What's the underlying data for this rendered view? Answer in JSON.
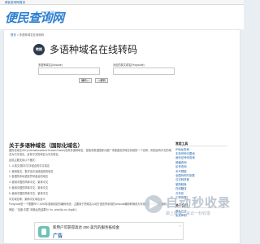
{
  "topbar": {
    "link": "便民查询网首页"
  },
  "header": {
    "logo_text": "便民查询网",
    "logo_url": "www.ip138.com"
  },
  "breadcrumb": {
    "prefix": "首页",
    "current": "多语种域名在线转码"
  },
  "main": {
    "badge": "转换",
    "title": "多语种域名在线转码",
    "form": {
      "input1_label": "多语种域名(Unicode)",
      "input2_label": "对应的英文域名(Punycode)",
      "btn_encode": "编码 ▷",
      "btn_decode": "◁ 解码"
    }
  },
  "section": {
    "title": "关于多语种域名（国际化域名）",
    "paragraphs": [
      "国际化域名IDN (Internationalized Domain Name)也称多语种域名，是指非英语国家为推广本国语言的域名系统的一个总称，例如含有中文的域名为中文域名，含有中文的域名为中文域名。",
      "目前主要支持以下格式：",
      "1. 以英文/数字/汉字组合的中文域名",
      "2. 使用英文、数字及中划线组成的域名",
      "3. 各国的本地语言符号组合的域名",
      "4. 使用中国的简体中文、繁体中文",
      "5. 使用中国的简体中文、繁体中文",
      "6. 使用中国的简体中文、繁体中文",
      "中文域名等，某网中文域名含义",
      "Punycode是一个根据RFC 3492标准而制定的编码系统，主要用于把域名从地方语言所采用的Unicode编码转换成为可用于DNS系统的编码。",
      "例如：\"百度.中国\" 转换后的结果为 \"xn--wxtr44c.xn--fiqs8s\"。"
    ]
  },
  "sidebar": {
    "head1": "常用工具",
    "items1": [
      "IP地址查询",
      "手机号码归属地",
      "身份证号码查询",
      "邮编查询",
      "区号查询",
      "天气预报",
      "全国列车时刻表",
      "汉字转拼音",
      "繁简转换",
      "在线翻译",
      "万年历",
      "汇率换算"
    ],
    "head2": "关于我们",
    "items2": [
      "联系方式",
      "免责声明"
    ]
  },
  "promo": {
    "line1": "新用户可获得高达 200 美元的服务抵扣金",
    "line2": "广告",
    "close": "×"
  },
  "watermark": {
    "title": "自动秒收录",
    "sub": "做上链接一来访一秒收录"
  }
}
